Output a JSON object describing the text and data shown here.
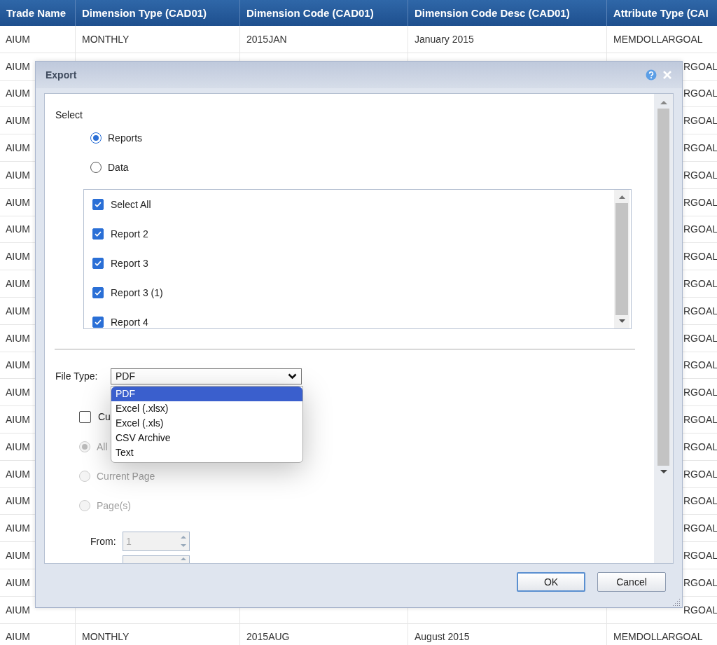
{
  "table": {
    "columns": [
      "Trade Name",
      "Dimension Type (CAD01)",
      "Dimension Code (CAD01)",
      "Dimension Code Desc (CAD01)",
      "Attribute Type (CAI"
    ],
    "rows": [
      {
        "kind": "full",
        "cells": [
          "AIUM",
          "MONTHLY",
          "2015JAN",
          "January 2015",
          "MEMDOLLARGOAL"
        ]
      },
      {
        "kind": "edges",
        "cells": [
          "AIUM",
          "RGOAL"
        ]
      },
      {
        "kind": "edges",
        "cells": [
          "AIUM",
          "RGOAL"
        ]
      },
      {
        "kind": "edges",
        "cells": [
          "AIUM",
          "RGOAL"
        ]
      },
      {
        "kind": "edges",
        "cells": [
          "AIUM",
          "RGOAL"
        ]
      },
      {
        "kind": "edges",
        "cells": [
          "AIUM",
          "RGOAL"
        ]
      },
      {
        "kind": "edges",
        "cells": [
          "AIUM",
          "RGOAL"
        ]
      },
      {
        "kind": "edges",
        "cells": [
          "AIUM",
          "RGOAL"
        ]
      },
      {
        "kind": "edges",
        "cells": [
          "AIUM",
          "RGOAL"
        ]
      },
      {
        "kind": "edges",
        "cells": [
          "AIUM",
          "RGOAL"
        ]
      },
      {
        "kind": "edges",
        "cells": [
          "AIUM",
          "RGOAL"
        ]
      },
      {
        "kind": "edges",
        "cells": [
          "AIUM",
          "RGOAL"
        ]
      },
      {
        "kind": "edges",
        "cells": [
          "AIUM",
          "RGOAL"
        ]
      },
      {
        "kind": "edges",
        "cells": [
          "AIUM",
          "RGOAL"
        ]
      },
      {
        "kind": "edges",
        "cells": [
          "AIUM",
          "RGOAL"
        ]
      },
      {
        "kind": "edges",
        "cells": [
          "AIUM",
          "RGOAL"
        ]
      },
      {
        "kind": "edges",
        "cells": [
          "AIUM",
          "RGOAL"
        ]
      },
      {
        "kind": "edges",
        "cells": [
          "AIUM",
          "RGOAL"
        ]
      },
      {
        "kind": "edges",
        "cells": [
          "AIUM",
          "RGOAL"
        ]
      },
      {
        "kind": "edges",
        "cells": [
          "AIUM",
          "RGOAL"
        ]
      },
      {
        "kind": "edges",
        "cells": [
          "AIUM",
          "RGOAL"
        ]
      },
      {
        "kind": "edges",
        "cells": [
          "AIUM",
          "RGOAL"
        ]
      },
      {
        "kind": "full",
        "cells": [
          "AIUM",
          "MONTHLY",
          "2015AUG",
          "August 2015",
          "MEMDOLLARGOAL"
        ]
      }
    ]
  },
  "dialog": {
    "title": "Export",
    "select_label": "Select",
    "export_options": [
      {
        "label": "Reports",
        "selected": true
      },
      {
        "label": "Data",
        "selected": false
      }
    ],
    "reports": [
      {
        "label": "Select All",
        "checked": true
      },
      {
        "label": "Report 2",
        "checked": true
      },
      {
        "label": "Report 3",
        "checked": true
      },
      {
        "label": "Report 3 (1)",
        "checked": true
      },
      {
        "label": "Report 4",
        "checked": true
      }
    ],
    "file_type": {
      "label": "File Type:",
      "value": "PDF",
      "expanded": true,
      "options": [
        {
          "label": "PDF",
          "selected": true
        },
        {
          "label": "Excel (.xlsx)",
          "selected": false
        },
        {
          "label": "Excel (.xls)",
          "selected": false
        },
        {
          "label": "CSV Archive",
          "selected": false
        },
        {
          "label": "Text",
          "selected": false
        }
      ]
    },
    "custom_option": {
      "label": "Cu",
      "checked": false
    },
    "page_range": [
      {
        "label": "All",
        "selected": true,
        "disabled": true
      },
      {
        "label": "Current Page",
        "selected": false,
        "disabled": true
      },
      {
        "label": "Page(s)",
        "selected": false,
        "disabled": true
      }
    ],
    "from": {
      "label": "From:",
      "value": "1",
      "disabled": true
    },
    "buttons": [
      {
        "label": "OK",
        "kind": "primary"
      },
      {
        "label": "Cancel",
        "kind": "secondary"
      }
    ]
  }
}
